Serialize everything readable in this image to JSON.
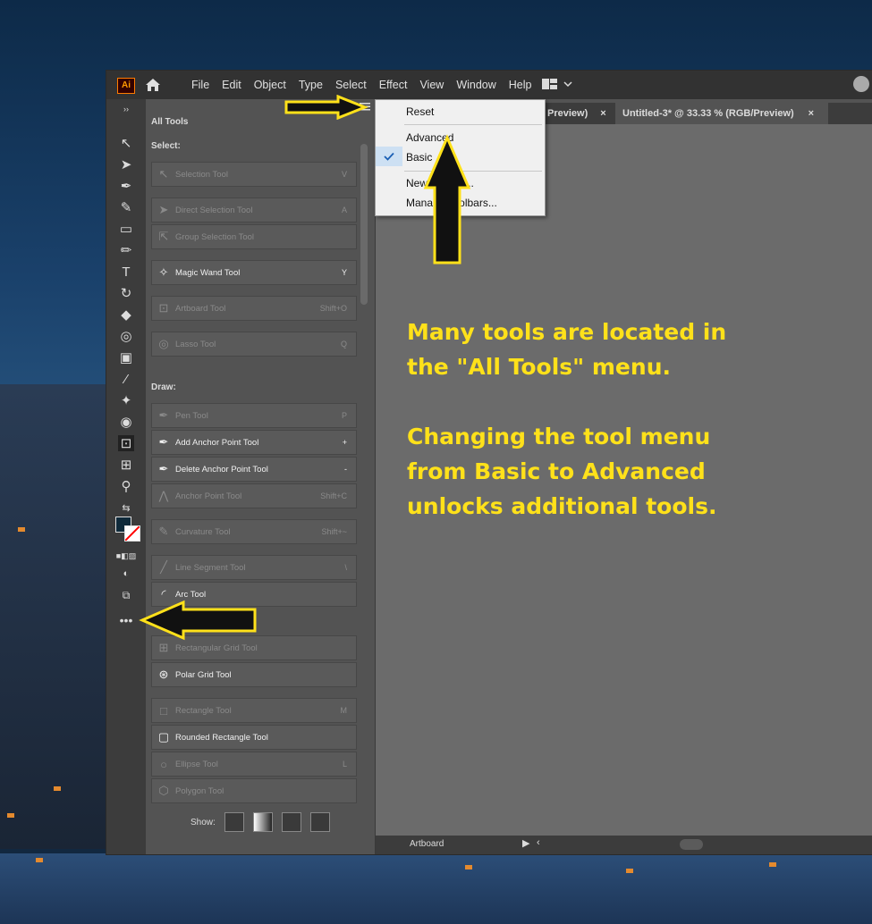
{
  "app": {
    "logo_text": "Ai",
    "menu": [
      "File",
      "Edit",
      "Object",
      "Type",
      "Select",
      "Effect",
      "View",
      "Window",
      "Help"
    ]
  },
  "tabs": [
    {
      "label": "Preview)"
    },
    {
      "label": "Untitled-3* @ 33.33 % (RGB/Preview)"
    }
  ],
  "panel": {
    "title": "All Tools",
    "sections": [
      {
        "label": "Select:"
      },
      {
        "label": "Draw:"
      }
    ],
    "tools": [
      {
        "name": "Selection Tool",
        "key": "V",
        "enabled": false,
        "icon": "selection-icon"
      },
      {
        "name": "Direct Selection Tool",
        "key": "A",
        "enabled": false,
        "icon": "direct-selection-icon"
      },
      {
        "name": "Group Selection Tool",
        "key": "",
        "enabled": false,
        "icon": "group-selection-icon"
      },
      {
        "name": "Magic Wand Tool",
        "key": "Y",
        "enabled": true,
        "icon": "magic-wand-icon"
      },
      {
        "name": "Artboard Tool",
        "key": "Shift+O",
        "enabled": false,
        "icon": "artboard-icon"
      },
      {
        "name": "Lasso Tool",
        "key": "Q",
        "enabled": false,
        "icon": "lasso-icon"
      },
      {
        "name": "Pen Tool",
        "key": "P",
        "enabled": false,
        "icon": "pen-icon"
      },
      {
        "name": "Add Anchor Point Tool",
        "key": "+",
        "enabled": true,
        "icon": "add-anchor-icon"
      },
      {
        "name": "Delete Anchor Point Tool",
        "key": "-",
        "enabled": true,
        "icon": "delete-anchor-icon"
      },
      {
        "name": "Anchor Point Tool",
        "key": "Shift+C",
        "enabled": false,
        "icon": "anchor-point-icon"
      },
      {
        "name": "Curvature Tool",
        "key": "Shift+~",
        "enabled": false,
        "icon": "curvature-icon"
      },
      {
        "name": "Line Segment Tool",
        "key": "\\",
        "enabled": false,
        "icon": "line-segment-icon"
      },
      {
        "name": "Arc Tool",
        "key": "",
        "enabled": true,
        "icon": "arc-icon"
      },
      {
        "name": "Rectangular Grid Tool",
        "key": "",
        "enabled": false,
        "icon": "rect-grid-icon"
      },
      {
        "name": "Polar Grid Tool",
        "key": "",
        "enabled": true,
        "icon": "polar-grid-icon"
      },
      {
        "name": "Rectangle Tool",
        "key": "M",
        "enabled": false,
        "icon": "rectangle-icon"
      },
      {
        "name": "Rounded Rectangle Tool",
        "key": "",
        "enabled": true,
        "icon": "rounded-rect-icon"
      },
      {
        "name": "Ellipse Tool",
        "key": "L",
        "enabled": false,
        "icon": "ellipse-icon"
      },
      {
        "name": "Polygon Tool",
        "key": "",
        "enabled": false,
        "icon": "polygon-icon"
      }
    ],
    "show_label": "Show:"
  },
  "popup": {
    "items": [
      "Reset",
      "Advanced",
      "Basic",
      "New Toolbar...",
      "Manage Toolbars..."
    ],
    "checked": "Basic"
  },
  "status": {
    "artboard_label": "Artboard"
  },
  "annotation": {
    "line1": "Many tools are located in",
    "line2": "the \"All Tools\" menu.",
    "line3": "Changing the tool menu",
    "line4": "from Basic to Advanced",
    "line5": "unlocks additional tools."
  },
  "colors": {
    "annotation": "#ffe11a",
    "menubar": "#323232",
    "panel": "#535353"
  }
}
